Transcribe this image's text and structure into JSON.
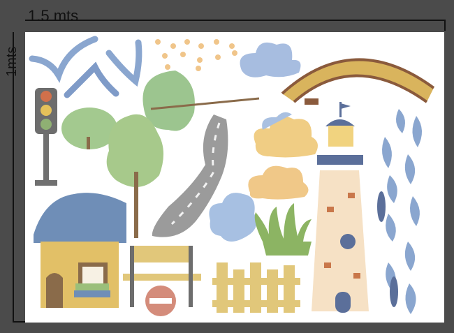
{
  "dimensions": {
    "width_label": "1.5 mts",
    "height_label": "1mts"
  },
  "sheet": {
    "background": "#ffffff",
    "elements": [
      "seagull-icon",
      "seagull-icon",
      "seagull-icon",
      "stars",
      "cloud-icon",
      "bridge-icon",
      "traffic-light-icon",
      "bush-icon",
      "leaf-icon",
      "tree-icon",
      "road-icon",
      "cloud-icon",
      "cloud-icon",
      "lighthouse-icon",
      "fish-school-icon",
      "house-icon",
      "bench-icon",
      "road-sign-icon",
      "fence-icon",
      "grass-icon"
    ]
  },
  "colors": {
    "frame": "#4b4b4b",
    "sky_blue": "#8aa6cf",
    "sand": "#e2c067",
    "green": "#98c383",
    "road": "#9b9b9b",
    "brick": "#c9774a"
  }
}
